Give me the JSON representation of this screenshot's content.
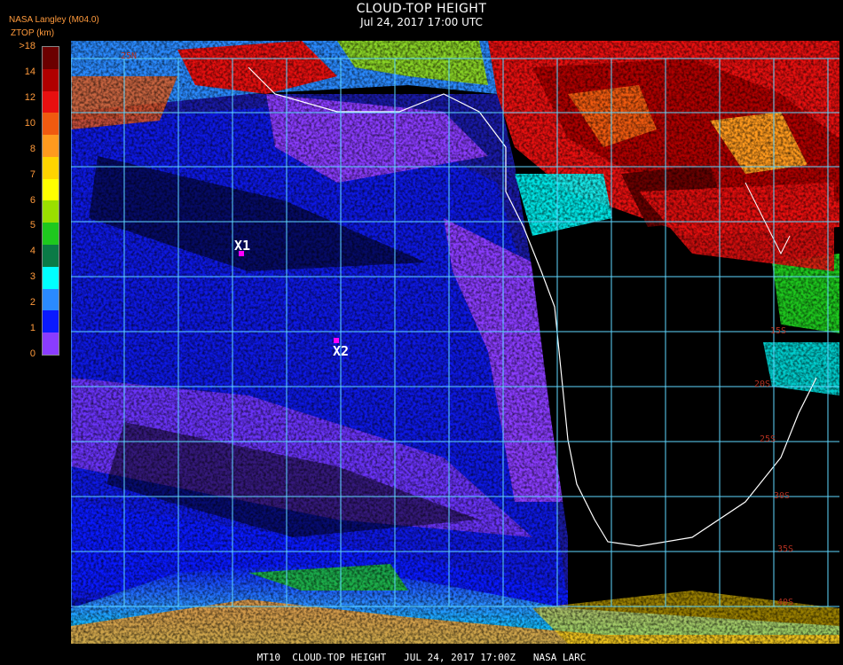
{
  "header": {
    "title": "CLOUD-TOP HEIGHT",
    "subtitle": "Jul 24, 2017 17:00 UTC"
  },
  "legend": {
    "provider": "NASA Langley (M04.0)",
    "units": "ZTOP (km)",
    "ticks": [
      ">18",
      "14",
      "12",
      "10",
      "8",
      "7",
      "6",
      "5",
      "4",
      "3",
      "2",
      "1",
      "0"
    ],
    "colors": [
      "#6b0000",
      "#b00000",
      "#e81010",
      "#f05a10",
      "#ff9a1e",
      "#ffd400",
      "#ffff00",
      "#9adf00",
      "#1ec81e",
      "#0a7a46",
      "#00ffff",
      "#2a8aff",
      "#0a1aff",
      "#8a3cff"
    ]
  },
  "map": {
    "grid_labels": [
      "25N",
      "15S",
      "20S",
      "25S",
      "30S",
      "35S",
      "40S"
    ],
    "points": [
      {
        "label": "X1",
        "color": "#ff00ff"
      },
      {
        "label": "X2",
        "color": "#ff00ff"
      }
    ],
    "gridline_color": "#5fd7ff",
    "coastline_color": "#ffffff"
  },
  "footer": {
    "text": "MT10  CLOUD-TOP HEIGHT   JUL 24, 2017 17:00Z   NASA LARC"
  }
}
